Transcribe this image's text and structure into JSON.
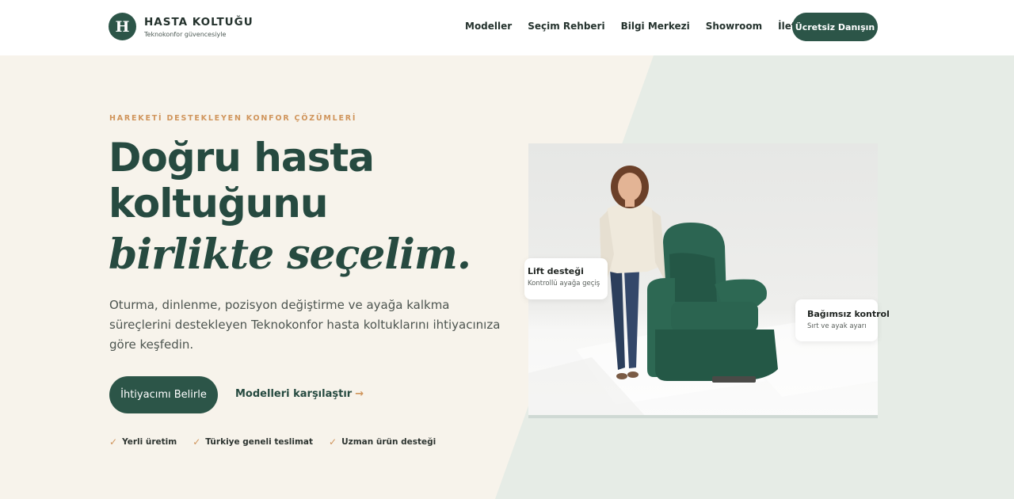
{
  "brand": {
    "mark": "H",
    "name": "HASTA KOLTUĞU",
    "tagline": "Teknokonfor güvencesiyle"
  },
  "nav": {
    "items": [
      {
        "label": "Modeller"
      },
      {
        "label": "Seçim Rehberi"
      },
      {
        "label": "Bilgi Merkezi"
      },
      {
        "label": "Showroom"
      },
      {
        "label": "İletişim"
      }
    ],
    "cta": "Ücretsiz Danışın"
  },
  "hero": {
    "eyebrow": "HAREKETİ DESTEKLEYEN KONFOR ÇÖZÜMLERİ",
    "title_line1": "Doğru hasta",
    "title_line2": "koltuğunu",
    "title_italic": "birlikte seçelim.",
    "lead": "Oturma, dinlenme, pozisyon değiştirme ve ayağa kalkma süreçlerini destekleyen Teknokonfor hasta koltuklarını ihtiyacınıza göre keşfedin.",
    "primary_button": "İhtiyacımı Belirle",
    "secondary_link": "Modelleri karşılaştır",
    "secondary_arrow": "→",
    "features": [
      {
        "label": "Yerli üretim"
      },
      {
        "label": "Türkiye geneli teslimat"
      },
      {
        "label": "Uzman ürün desteği"
      }
    ],
    "check_glyph": "✓"
  },
  "badges": {
    "lift": {
      "title": "Lift desteği",
      "subtitle": "Kontrollü ayağa geçiş"
    },
    "control": {
      "title": "Bağımsız kontrol",
      "subtitle": "Sırt ve ayak ayarı"
    }
  },
  "colors": {
    "primary": "#2c5548",
    "accent": "#d0955c",
    "cream": "#f7f3eb",
    "mint": "#e6ece6"
  }
}
